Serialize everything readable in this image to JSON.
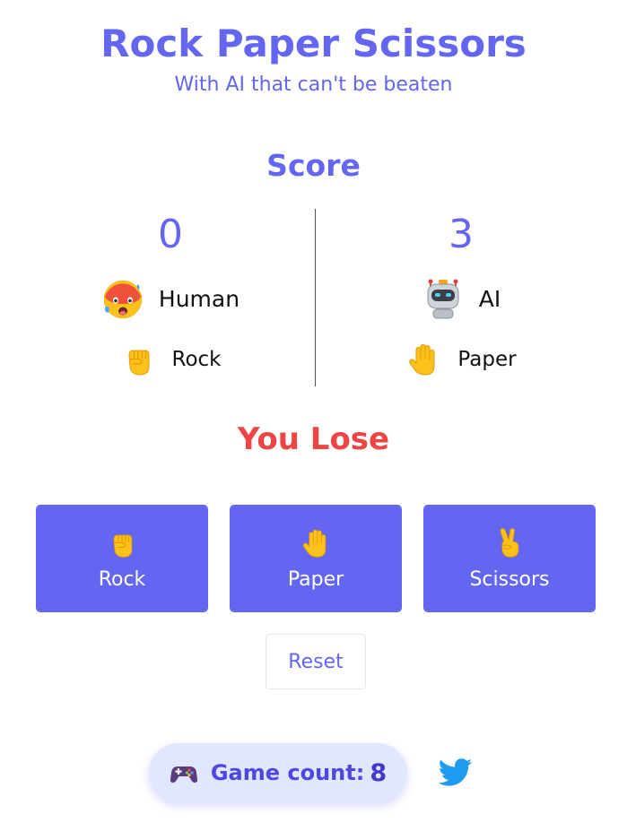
{
  "header": {
    "title": "Rock Paper Scissors",
    "subtitle": "With AI that can't be beaten"
  },
  "score": {
    "heading": "Score",
    "human": {
      "points": "0",
      "name": "Human",
      "avatar_icon": "hot-face-icon",
      "move": "Rock",
      "move_icon": "raised-fist-icon"
    },
    "ai": {
      "points": "3",
      "name": "AI",
      "avatar_icon": "robot-icon",
      "move": "Paper",
      "move_icon": "raised-hand-icon"
    }
  },
  "result": "You Lose",
  "choices": [
    {
      "label": "Rock",
      "icon": "raised-fist-icon"
    },
    {
      "label": "Paper",
      "icon": "raised-hand-icon"
    },
    {
      "label": "Scissors",
      "icon": "victory-hand-icon"
    }
  ],
  "reset_label": "Reset",
  "game_count": {
    "label": "Game count:",
    "value": "8",
    "icon": "game-controller-icon"
  },
  "social": {
    "icon": "twitter-icon"
  },
  "colors": {
    "accent": "#6366f1",
    "lose": "#ef4444",
    "pill_bg": "#e0e7ff",
    "twitter": "#1d9bf0"
  }
}
